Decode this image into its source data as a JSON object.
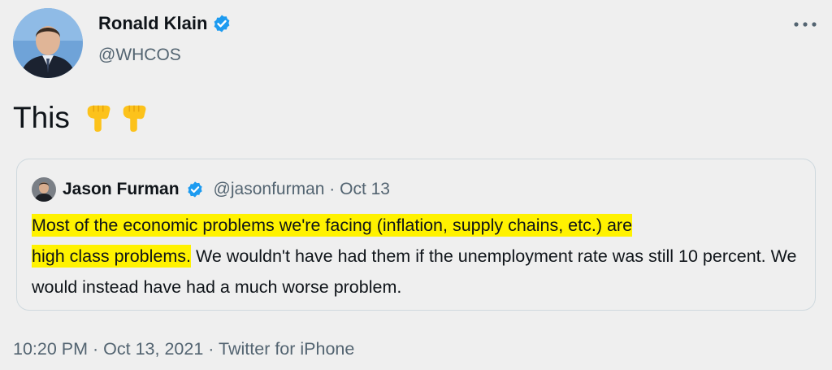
{
  "author": {
    "name": "Ronald Klain",
    "handle": "@WHCOS",
    "verified": true
  },
  "menu": {
    "more_icon": "more-horizontal-icon"
  },
  "tweet": {
    "text": "This",
    "emojis": [
      "backhand-index-pointing-down",
      "backhand-index-pointing-down"
    ]
  },
  "quote": {
    "name": "Jason Furman",
    "handle": "@jasonfurman",
    "separator": "·",
    "date": "Oct 13",
    "verified": true,
    "body_highlighted_1": "Most of the economic problems we're facing (inflation, supply chains, etc.) are",
    "body_highlighted_2": "high class problems.",
    "body_rest": " We wouldn't have had them if the unemployment rate was still 10 percent. We would instead have had a much worse problem."
  },
  "footer": {
    "time": "10:20 PM",
    "sep1": "·",
    "date": "Oct 13, 2021",
    "sep2": "·",
    "source": "Twitter for iPhone"
  },
  "colors": {
    "verified_blue": "#1d9bf0",
    "highlight": "#fff200",
    "secondary_text": "#536471"
  }
}
